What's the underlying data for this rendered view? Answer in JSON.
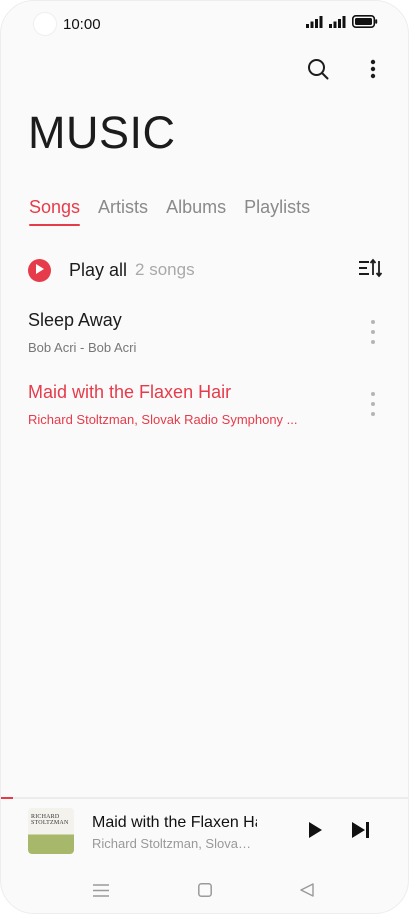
{
  "status_bar": {
    "time": "10:00"
  },
  "header": {
    "title": "MUSIC"
  },
  "tabs": [
    {
      "label": "Songs",
      "active": true
    },
    {
      "label": "Artists",
      "active": false
    },
    {
      "label": "Albums",
      "active": false
    },
    {
      "label": "Playlists",
      "active": false
    }
  ],
  "play_all": {
    "label": "Play all",
    "count": "2 songs"
  },
  "songs": [
    {
      "title": "Sleep Away",
      "subtitle": "Bob Acri - Bob Acri",
      "playing": false
    },
    {
      "title": "Maid with the Flaxen Hair",
      "subtitle": "Richard Stoltzman, Slovak Radio Symphony ...",
      "playing": true
    }
  ],
  "now_playing": {
    "title": "Maid with the Flaxen Hair",
    "subtitle": "Richard Stoltzman, Slovak Radio Symphony Orchestra",
    "cover_text": "RICHARD STOLTZMAN",
    "progress": 0.03
  },
  "colors": {
    "accent": "#e63b4a",
    "text": "#1c1c1c",
    "muted": "#8a8a8a",
    "background": "#fafafa"
  },
  "icons": {
    "toolbar": [
      "search-icon",
      "more-vertical-icon"
    ],
    "status": [
      "wifi-icon",
      "signal-icon",
      "battery-icon"
    ],
    "nav": [
      "menu-icon",
      "home-icon",
      "back-icon"
    ]
  }
}
